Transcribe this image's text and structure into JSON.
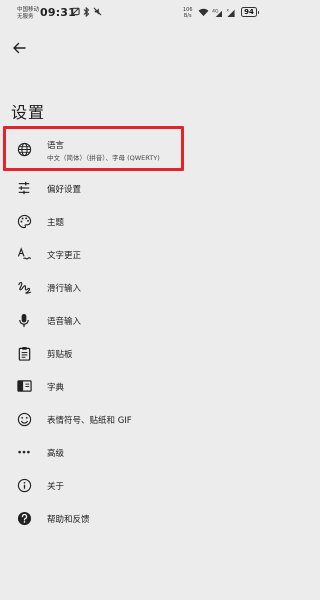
{
  "status_bar": {
    "carrier_line1": "中国移动",
    "carrier_line2": "无服务",
    "time": "09:31",
    "speed_value": "106",
    "speed_unit": "B/s",
    "battery": "94"
  },
  "header": {
    "title": "设置"
  },
  "menu": {
    "language": {
      "label": "语言",
      "sublabel": "中文（简体）（拼音）、字母 (QWERTY)",
      "icon": "globe-icon"
    },
    "preferences": {
      "label": "偏好设置",
      "icon": "sliders-icon"
    },
    "theme": {
      "label": "主题",
      "icon": "palette-icon"
    },
    "text_correction": {
      "label": "文字更正",
      "icon": "spellcheck-icon"
    },
    "glide_typing": {
      "label": "滑行输入",
      "icon": "gesture-icon"
    },
    "voice_input": {
      "label": "语音输入",
      "icon": "mic-icon"
    },
    "clipboard": {
      "label": "剪贴板",
      "icon": "clipboard-icon"
    },
    "dictionary": {
      "label": "字典",
      "icon": "book-icon"
    },
    "emoji": {
      "label": "表情符号、贴纸和 GIF",
      "icon": "emoji-icon"
    },
    "advanced": {
      "label": "高级",
      "icon": "more-icon"
    },
    "about": {
      "label": "关于",
      "icon": "info-icon"
    },
    "help": {
      "label": "帮助和反馈",
      "icon": "help-icon"
    }
  },
  "highlight_color": "#e2252b"
}
